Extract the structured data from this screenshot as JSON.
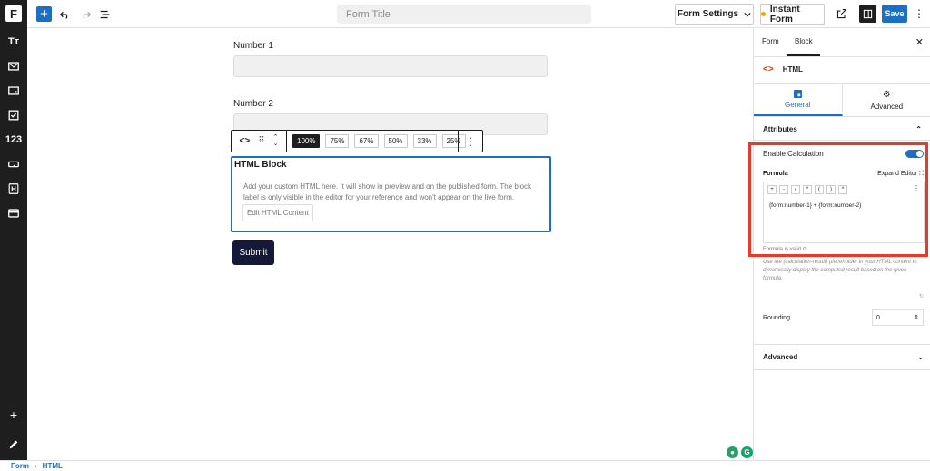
{
  "topbar": {
    "form_title_placeholder": "Form Title",
    "form_settings": "Form Settings",
    "instant_form": "Instant Form",
    "save": "Save"
  },
  "rail": {
    "items": [
      {
        "icon": "text-icon",
        "label": "Tт"
      },
      {
        "icon": "email-icon",
        "label": ""
      },
      {
        "icon": "input-icon",
        "label": ""
      },
      {
        "icon": "checkbox-icon",
        "label": ""
      },
      {
        "icon": "number-icon",
        "label": "123"
      },
      {
        "icon": "button-icon",
        "label": ""
      },
      {
        "icon": "heading-icon",
        "label": "H"
      },
      {
        "icon": "card-icon",
        "label": ""
      }
    ]
  },
  "canvas": {
    "number1_label": "Number 1",
    "number2_label": "Number 2",
    "width_options": [
      "100%",
      "75%",
      "67%",
      "50%",
      "33%",
      "25%"
    ],
    "selected_width": "100%",
    "html_block": {
      "title": "HTML Block",
      "description": "Add your custom HTML here. It will show in preview and on the published form. The block label is only visible in the editor for your reference and won't appear on the live form.",
      "edit_button": "Edit HTML Content"
    },
    "submit": "Submit"
  },
  "sidebar": {
    "tabs": [
      "Form",
      "Block"
    ],
    "active_tab": "Block",
    "block_name": "HTML",
    "subtabs": [
      "General",
      "Advanced"
    ],
    "attributes": "Attributes",
    "enable_calculation": "Enable Calculation",
    "enable_calculation_on": true,
    "formula_label": "Formula",
    "expand_editor": "Expand Editor",
    "operators": [
      "+",
      "-",
      "/",
      "*",
      "(",
      ")",
      "^"
    ],
    "formula_value": "{form:number-1} + {form:number-2}",
    "formula_valid": "Formula is valid",
    "help_text": "Use the {calculation-result} placeholder in your HTML content to dynamically display the computed result based on the given formula.",
    "rounding_label": "Rounding",
    "rounding_value": "0",
    "advanced": "Advanced"
  },
  "breadcrumb": [
    "Form",
    "HTML"
  ],
  "colors": {
    "accent": "#1e6fc2",
    "highlight": "#e43b2a",
    "submit_bg": "#14193a",
    "rail_bg": "#1e1e1e"
  }
}
